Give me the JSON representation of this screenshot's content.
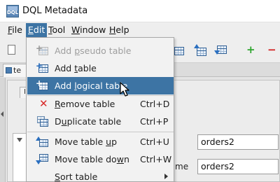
{
  "window": {
    "title": "DQL Metadata",
    "icon_text": "DQL"
  },
  "menubar": {
    "items": [
      {
        "label": "File",
        "underline": "F"
      },
      {
        "label": "Edit",
        "underline": "E",
        "active": true
      },
      {
        "label": "Tool",
        "underline": "T"
      },
      {
        "label": "Window",
        "underline": "W"
      },
      {
        "label": "Help",
        "underline": "H"
      }
    ]
  },
  "toolbar": {
    "icons": [
      "new-document-icon",
      "table-icon",
      "move-table-up-icon",
      "move-table-down-icon",
      "add-icon",
      "remove-icon"
    ]
  },
  "workspace": {
    "doc_tab_label": "te",
    "inner_tab_label": "I"
  },
  "edit_menu": {
    "items": [
      {
        "id": "add-pseudo-table",
        "label_pre": "Add ",
        "label_u": "p",
        "label_post": "seudo table",
        "shortcut": "",
        "enabled": false,
        "icon": "add-pseudo-table-icon"
      },
      {
        "id": "add-table",
        "label_pre": "Add ",
        "label_u": "t",
        "label_post": "able",
        "shortcut": "",
        "enabled": true,
        "icon": "add-table-icon"
      },
      {
        "id": "add-logical-table",
        "label_pre": "Add ",
        "label_u": "l",
        "label_post": "ogical table",
        "shortcut": "",
        "enabled": true,
        "highlighted": true,
        "icon": "add-logical-table-icon"
      },
      {
        "id": "remove-table",
        "label_pre": "",
        "label_u": "R",
        "label_post": "emove table",
        "shortcut": "Ctrl+D",
        "enabled": true,
        "icon": "remove-icon"
      },
      {
        "id": "duplicate-table",
        "label_pre": "D",
        "label_u": "u",
        "label_post": "plicate table",
        "shortcut": "Ctrl+P",
        "enabled": true,
        "icon": "duplicate-table-icon"
      },
      {
        "id": "move-table-up",
        "label_pre": "Move table ",
        "label_u": "u",
        "label_post": "p",
        "shortcut": "Ctrl+U",
        "enabled": true,
        "icon": "move-table-up-icon"
      },
      {
        "id": "move-table-down",
        "label_pre": "Move table do",
        "label_u": "w",
        "label_post": "n",
        "shortcut": "Ctrl+W",
        "enabled": true,
        "icon": "move-table-down-icon"
      },
      {
        "id": "sort-table",
        "label_pre": "",
        "label_u": "S",
        "label_post": "ort table",
        "shortcut": "",
        "enabled": true,
        "submenu": true,
        "icon": ""
      }
    ]
  },
  "properties": {
    "table_name_value": "orders2",
    "name_label_fragment": "me",
    "name_value": "orders2"
  },
  "colors": {
    "highlight": "#3d74a4",
    "disabled_text": "#9e9e9e",
    "menu_bg": "#f2f2f2"
  }
}
